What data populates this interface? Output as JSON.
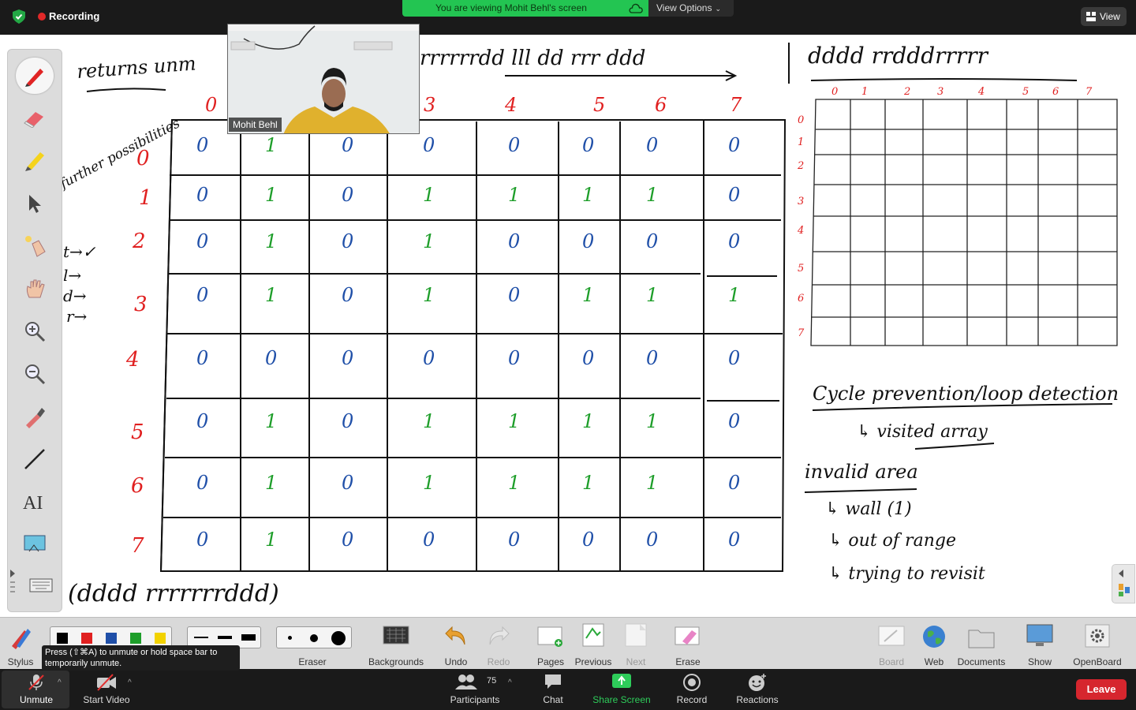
{
  "topbar": {
    "recording_label": "Recording",
    "viewing_banner": "You are viewing Mohit Behl's screen",
    "view_options_label": "View Options",
    "view_button_label": "View"
  },
  "webcam": {
    "name": "Mohit Behl"
  },
  "whiteboard": {
    "left_notes": [
      "returns unm",
      "further possibilities",
      "t→✓",
      "l→",
      "d→",
      "r→"
    ],
    "top_path": "rrrrrrdd lll dd rrr ddd",
    "right_path": "dddd rrdddrrrrr",
    "bottom_path": "(dddd rrrrrrrddd)",
    "col_indices": [
      "0",
      "1",
      "2",
      "3",
      "4",
      "5",
      "6",
      "7"
    ],
    "row_indices": [
      "0",
      "1",
      "2",
      "3",
      "4",
      "5",
      "6",
      "7"
    ],
    "maze": [
      [
        "0",
        "1",
        "0",
        "0",
        "0",
        "0",
        "0",
        "0"
      ],
      [
        "0",
        "1",
        "0",
        "1",
        "1",
        "1",
        "1",
        "0"
      ],
      [
        "0",
        "1",
        "0",
        "1",
        "0",
        "0",
        "0",
        "0"
      ],
      [
        "0",
        "1",
        "0",
        "1",
        "0",
        "1",
        "1",
        "1"
      ],
      [
        "0",
        "0",
        "0",
        "0",
        "0",
        "0",
        "0",
        "0"
      ],
      [
        "0",
        "1",
        "0",
        "1",
        "1",
        "1",
        "1",
        "0"
      ],
      [
        "0",
        "1",
        "0",
        "1",
        "1",
        "1",
        "1",
        "0"
      ],
      [
        "0",
        "1",
        "0",
        "0",
        "0",
        "0",
        "0",
        "0"
      ]
    ],
    "notes_right": {
      "cycle": "Cycle prevention/loop detection",
      "visited": "↳ visited array",
      "invalid": "invalid area",
      "wall": "↳ wall (1)",
      "range": "↳ out of range",
      "revisit": "↳ trying to revisit"
    }
  },
  "palette_tools": [
    "pen-tool-icon",
    "eraser-tool-icon",
    "highlighter-tool-icon",
    "select-arrow-icon",
    "laser-pointer-icon",
    "pan-hand-icon",
    "zoom-in-icon",
    "zoom-out-icon",
    "eyedropper-icon",
    "line-tool-icon",
    "text-tool-icon",
    "screenshot-tool-icon",
    "keyboard-icon"
  ],
  "drawbar": {
    "stylus": "Stylus",
    "eraser": "Eraser",
    "backgrounds": "Backgrounds",
    "undo": "Undo",
    "redo": "Redo",
    "pages": "Pages",
    "previous": "Previous",
    "next": "Next",
    "erase": "Erase",
    "board": "Board",
    "web": "Web",
    "documents": "Documents",
    "show_desktop": "Show Desktop",
    "openboard": "OpenBoard",
    "colors": [
      "#000000",
      "#e02020",
      "#1f4fa8",
      "#1e9e2a",
      "#f2d200"
    ]
  },
  "tooltip": {
    "line1": "Press  (⇧⌘A) to unmute or hold space bar to",
    "line2": "temporarily unmute."
  },
  "zoombar": {
    "unmute": "Unmute",
    "start_video": "Start Video",
    "participants": "Participants",
    "participant_count": "75",
    "chat": "Chat",
    "share_screen": "Share Screen",
    "record": "Record",
    "reactions": "Reactions",
    "leave": "Leave"
  }
}
